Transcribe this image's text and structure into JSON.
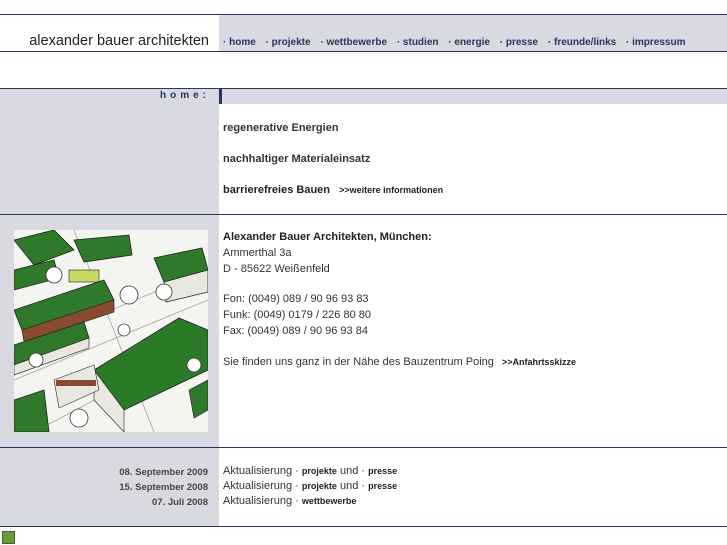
{
  "site": {
    "title": "alexander bauer architekten"
  },
  "nav": {
    "items": [
      "· home",
      "· projekte",
      "· wettbewerbe",
      "· studien",
      "· energie",
      "· presse",
      "· freunde/links",
      "· impressum"
    ]
  },
  "section": {
    "label": "home:"
  },
  "topics": {
    "line1": "regenerative Energien",
    "line2": "nachhaltiger Materialeinsatz",
    "line3": "barrierefreies Bauen",
    "more_link": ">>weitere informationen"
  },
  "contact": {
    "heading": "Alexander Bauer Architekten, München:",
    "street": "Ammerthal 3a",
    "city": "D - 85622 Weißenfeld",
    "phone": "Fon: (0049) 089 / 90 96 93 83",
    "mobile": "Funk: (0049) 0179 / 226 80 80",
    "fax": "Fax: (0049) 089 / 90 96 93 84",
    "directions_text": "Sie finden uns ganz in der Nähe des Bauzentrum Poing",
    "directions_link": ">>Anfahrtsskizze"
  },
  "updates": [
    {
      "date": "08. September 2009",
      "prefix": "Aktualisierung ·",
      "link1": "projekte",
      "mid": "und ·",
      "link2": "presse"
    },
    {
      "date": "15. September 2008",
      "prefix": "Aktualisierung ·",
      "link1": "projekte",
      "mid": "und ·",
      "link2": "presse"
    },
    {
      "date": "07. Juli 2008",
      "prefix": "Aktualisierung ·",
      "link1": "wettbewerbe",
      "mid": "",
      "link2": ""
    }
  ],
  "colors": {
    "navy": "#2a3560",
    "grey_panel": "#d9d9e1",
    "roof_green": "#2f7a2a"
  }
}
